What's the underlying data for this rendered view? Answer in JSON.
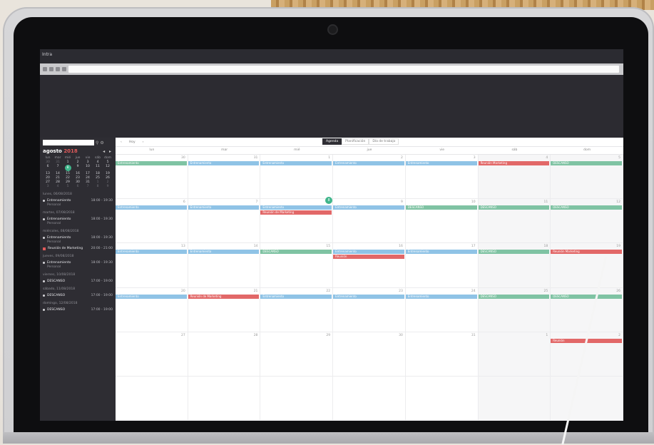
{
  "browser": {
    "tab_title": "Intra",
    "url": ""
  },
  "sidebar": {
    "search_placeholder": "",
    "month": "agosto",
    "year": "2018",
    "weekdays": [
      "lun",
      "mar",
      "mié",
      "jue",
      "vie",
      "sáb",
      "dom"
    ],
    "mini_days": [
      [
        "30",
        "31",
        "1",
        "2",
        "3",
        "4",
        "5"
      ],
      [
        "6",
        "7",
        "8",
        "9",
        "10",
        "11",
        "12"
      ],
      [
        "13",
        "14",
        "15",
        "16",
        "17",
        "18",
        "19"
      ],
      [
        "20",
        "21",
        "22",
        "23",
        "24",
        "25",
        "26"
      ],
      [
        "27",
        "28",
        "29",
        "30",
        "31",
        "1",
        "2"
      ],
      [
        "3",
        "4",
        "5",
        "6",
        "7",
        "8",
        "9"
      ]
    ],
    "today": "8",
    "agenda": [
      {
        "date": "lunes, 06/08/2018",
        "items": [
          {
            "title": "Entrenamiento",
            "sub": "Personal",
            "time": "18:00 - 19:30",
            "color": "white"
          }
        ]
      },
      {
        "date": "martes, 07/08/2018",
        "items": [
          {
            "title": "Entrenamiento",
            "sub": "Personal",
            "time": "18:00 - 19:30",
            "color": "white"
          }
        ]
      },
      {
        "date": "miércoles, 08/08/2018",
        "items": [
          {
            "title": "Entrenamiento",
            "sub": "Personal",
            "time": "18:00 - 19:30",
            "color": "white"
          },
          {
            "title": "Reunión de Marketing",
            "sub": "",
            "time": "20:00 - 21:00",
            "color": "red"
          }
        ]
      },
      {
        "date": "jueves, 09/08/2018",
        "items": [
          {
            "title": "Entrenamiento",
            "sub": "Personal",
            "time": "18:00 - 19:30",
            "color": "white"
          }
        ]
      },
      {
        "date": "viernes, 10/08/2018",
        "items": [
          {
            "title": "DESCANSO",
            "sub": "",
            "time": "17:00 - 19:00",
            "color": "white"
          }
        ]
      },
      {
        "date": "sábado, 11/08/2018",
        "items": [
          {
            "title": "DESCANSO",
            "sub": "",
            "time": "17:00 - 19:00",
            "color": "white"
          }
        ]
      },
      {
        "date": "domingo, 12/08/2018",
        "items": [
          {
            "title": "DESCANSO",
            "sub": "",
            "time": "17:00 - 19:00",
            "color": "white"
          }
        ]
      }
    ]
  },
  "toolbar": {
    "today_label": "Hoy",
    "prev": "‹",
    "next": "›",
    "views": [
      "Agenda",
      "Planificación",
      "Día de trabajo"
    ],
    "active_view": "Agenda"
  },
  "calendar": {
    "weekdays": [
      "lun",
      "mar",
      "mié",
      "jue",
      "vie",
      "sáb",
      "dom"
    ],
    "weeks": [
      [
        "30",
        "31",
        "1",
        "2",
        "3",
        "4",
        "5"
      ],
      [
        "6",
        "7",
        "8",
        "9",
        "10",
        "11",
        "12"
      ],
      [
        "13",
        "14",
        "15",
        "16",
        "17",
        "18",
        "19"
      ],
      [
        "20",
        "21",
        "22",
        "23",
        "24",
        "25",
        "26"
      ],
      [
        "27",
        "28",
        "29",
        "30",
        "31",
        "1",
        "2"
      ],
      [
        "",
        "",
        "",
        "",
        "",
        "",
        ""
      ]
    ],
    "today_cell": "8",
    "events": [
      {
        "week": 0,
        "day": 0,
        "color": "green",
        "label": "Entrenamiento"
      },
      {
        "week": 0,
        "day": 1,
        "color": "blue",
        "label": "Entrenamiento"
      },
      {
        "week": 0,
        "day": 2,
        "color": "blue",
        "label": "Entrenamiento"
      },
      {
        "week": 0,
        "day": 3,
        "color": "blue",
        "label": "Entrenamiento"
      },
      {
        "week": 0,
        "day": 4,
        "color": "blue",
        "label": "Entrenamiento"
      },
      {
        "week": 0,
        "day": 5,
        "color": "red",
        "label": "Reunión Marketing"
      },
      {
        "week": 0,
        "day": 6,
        "color": "green",
        "label": "DESCANSO"
      },
      {
        "week": 1,
        "day": 0,
        "color": "blue",
        "label": "Entrenamiento"
      },
      {
        "week": 1,
        "day": 1,
        "color": "blue",
        "label": "Entrenamiento"
      },
      {
        "week": 1,
        "day": 2,
        "color": "blue",
        "label": "Entrenamiento"
      },
      {
        "week": 1,
        "day": 2,
        "color": "red",
        "label": "Reunión de Marketing",
        "row": 1
      },
      {
        "week": 1,
        "day": 3,
        "color": "blue",
        "label": "Entrenamiento"
      },
      {
        "week": 1,
        "day": 4,
        "color": "green",
        "label": "DESCANSO"
      },
      {
        "week": 1,
        "day": 5,
        "color": "green",
        "label": "DESCANSO"
      },
      {
        "week": 1,
        "day": 6,
        "color": "green",
        "label": "DESCANSO"
      },
      {
        "week": 2,
        "day": 0,
        "color": "blue",
        "label": "Entrenamiento"
      },
      {
        "week": 2,
        "day": 1,
        "color": "blue",
        "label": "Entrenamiento"
      },
      {
        "week": 2,
        "day": 2,
        "color": "green",
        "label": "DESCANSO"
      },
      {
        "week": 2,
        "day": 3,
        "color": "blue",
        "label": "Entrenamiento"
      },
      {
        "week": 2,
        "day": 3,
        "color": "red",
        "label": "Reunión",
        "row": 1
      },
      {
        "week": 2,
        "day": 4,
        "color": "blue",
        "label": "Entrenamiento"
      },
      {
        "week": 2,
        "day": 5,
        "color": "green",
        "label": "DESCANSO"
      },
      {
        "week": 2,
        "day": 6,
        "color": "red",
        "label": "Reunión Marketing"
      },
      {
        "week": 3,
        "day": 0,
        "color": "blue",
        "label": "Entrenamiento"
      },
      {
        "week": 3,
        "day": 1,
        "color": "red",
        "label": "Reunión de Marketing"
      },
      {
        "week": 3,
        "day": 2,
        "color": "blue",
        "label": "Entrenamiento"
      },
      {
        "week": 3,
        "day": 3,
        "color": "blue",
        "label": "Entrenamiento"
      },
      {
        "week": 3,
        "day": 4,
        "color": "blue",
        "label": "Entrenamiento"
      },
      {
        "week": 3,
        "day": 5,
        "color": "green",
        "label": "DESCANSO"
      },
      {
        "week": 3,
        "day": 6,
        "color": "green",
        "label": "DESCANSO"
      },
      {
        "week": 4,
        "day": 6,
        "color": "red",
        "label": "Reunión"
      }
    ]
  }
}
